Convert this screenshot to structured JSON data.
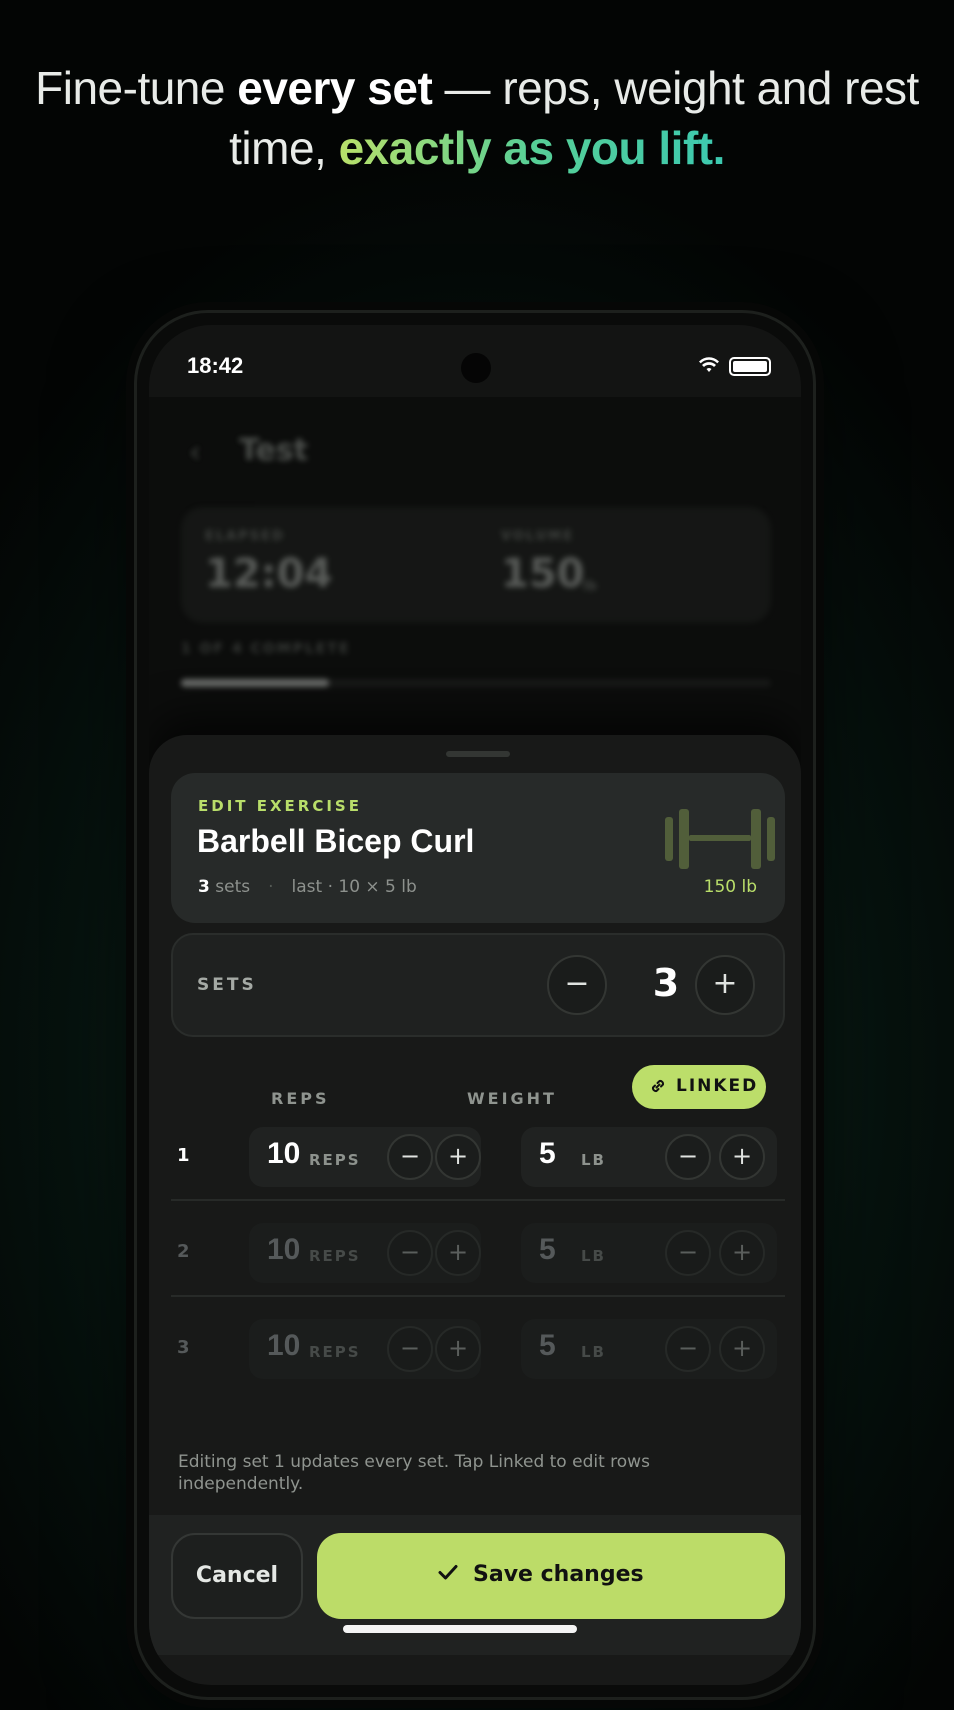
{
  "headline": {
    "part1": "Fine-tune ",
    "bold": "every set",
    "part2": " — reps, weight and rest time, ",
    "accent": "exactly as you lift."
  },
  "status_bar": {
    "time": "18:42"
  },
  "background_app": {
    "back_icon": "chevron-left-icon",
    "title": "Test",
    "stat1_label": "ELAPSED",
    "stat1_value": "12:04",
    "stat2_label": "VOLUME",
    "stat2_value": "150",
    "stat2_unit": "lb",
    "progress_label": "1 OF 4 COMPLETE",
    "progress_fraction": 0.25
  },
  "exercise": {
    "eyebrow": "EDIT EXERCISE",
    "name": "Barbell Bicep Curl",
    "sets_count": "3",
    "sets_word": " sets",
    "separator": "·",
    "last": "last · 10 × 5 lb",
    "total_weight": "150 lb"
  },
  "sets_control": {
    "label": "SETS",
    "value": "3",
    "minus": "−",
    "plus": "+"
  },
  "columns": {
    "reps": "REPS",
    "weight": "WEIGHT",
    "linked": "LINKED"
  },
  "rows": [
    {
      "index": "1",
      "reps": "10",
      "reps_unit": "REPS",
      "weight": "5",
      "weight_unit": "LB"
    },
    {
      "index": "2",
      "reps": "10",
      "reps_unit": "REPS",
      "weight": "5",
      "weight_unit": "LB"
    },
    {
      "index": "3",
      "reps": "10",
      "reps_unit": "REPS",
      "weight": "5",
      "weight_unit": "LB"
    }
  ],
  "stepper": {
    "minus": "−",
    "plus": "+"
  },
  "note": "Editing set 1 updates every set. Tap Linked to edit rows independently.",
  "footer": {
    "cancel": "Cancel",
    "save": "Save changes"
  },
  "colors": {
    "accent": "#bcdc68",
    "accent_text": "#b9de6a",
    "sheet_bg": "#181918"
  }
}
